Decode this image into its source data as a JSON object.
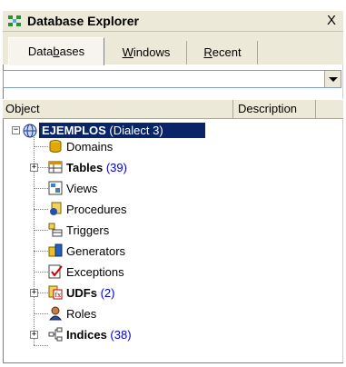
{
  "window": {
    "title": "Database Explorer",
    "close_glyph": "X"
  },
  "tabs": [
    {
      "label_pre": "Data",
      "label_u": "b",
      "label_post": "ases",
      "active": true
    },
    {
      "label_pre": "",
      "label_u": "W",
      "label_post": "indows",
      "active": false
    },
    {
      "label_pre": "",
      "label_u": "R",
      "label_post": "ecent",
      "active": false
    }
  ],
  "filter": {
    "value": ""
  },
  "columns": {
    "object": "Object",
    "description": "Description"
  },
  "tree": {
    "root": {
      "name": "EJEMPLOS",
      "suffix": "(Dialect 3)",
      "icon": "database-icon",
      "expanded": true,
      "selected": true
    },
    "items": [
      {
        "name": "Domains",
        "count": "",
        "bold": false,
        "icon": "domain-icon",
        "expandable": false
      },
      {
        "name": "Tables",
        "count": "(39)",
        "bold": true,
        "icon": "table-icon",
        "expandable": true
      },
      {
        "name": "Views",
        "count": "",
        "bold": false,
        "icon": "view-icon",
        "expandable": false
      },
      {
        "name": "Procedures",
        "count": "",
        "bold": false,
        "icon": "procedure-icon",
        "expandable": false
      },
      {
        "name": "Triggers",
        "count": "",
        "bold": false,
        "icon": "trigger-icon",
        "expandable": false
      },
      {
        "name": "Generators",
        "count": "",
        "bold": false,
        "icon": "generator-icon",
        "expandable": false
      },
      {
        "name": "Exceptions",
        "count": "",
        "bold": false,
        "icon": "exception-icon",
        "expandable": false
      },
      {
        "name": "UDFs",
        "count": "(2)",
        "bold": true,
        "icon": "udf-icon",
        "expandable": true
      },
      {
        "name": "Roles",
        "count": "",
        "bold": false,
        "icon": "role-icon",
        "expandable": false
      },
      {
        "name": "Indices",
        "count": "(38)",
        "bold": true,
        "icon": "index-icon",
        "expandable": true
      }
    ]
  },
  "colors": {
    "selection": "#0a246a",
    "count": "#0000d0",
    "chrome": "#ece9d8"
  }
}
